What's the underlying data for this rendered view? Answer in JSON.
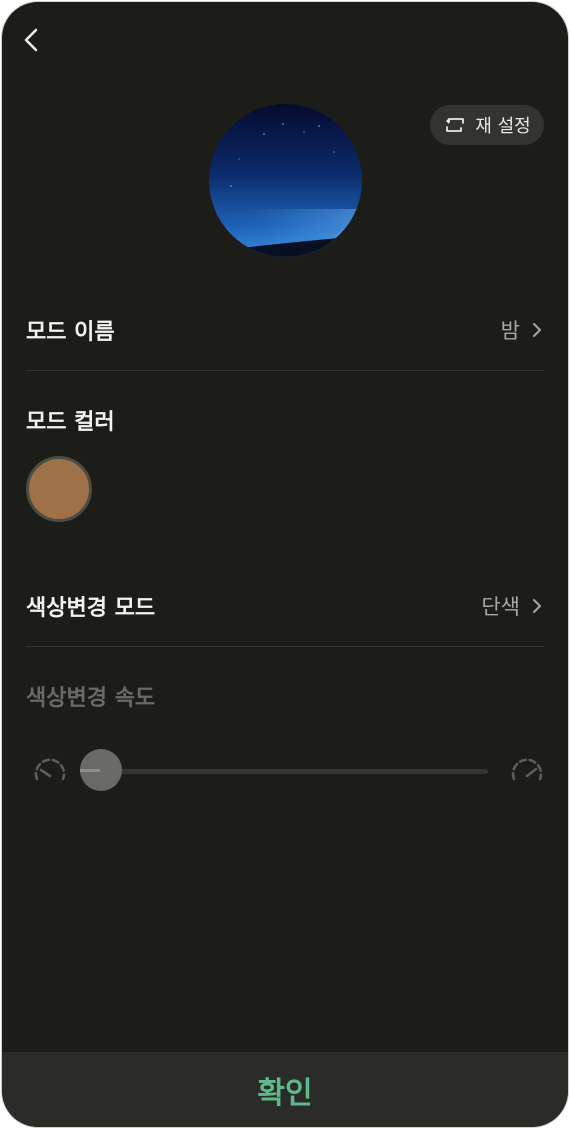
{
  "header": {
    "reset_label": "재 설정"
  },
  "mode_name": {
    "label": "모드 이름",
    "value": "밤"
  },
  "mode_color": {
    "label": "모드 컬러",
    "color": "#9f7149"
  },
  "color_change_mode": {
    "label": "색상변경 모드",
    "value": "단색"
  },
  "color_change_speed": {
    "label": "색상변경 속도",
    "level": 0
  },
  "footer": {
    "confirm_label": "확인"
  },
  "icons": {
    "back": "chevron-left-icon",
    "reset": "reset-icon",
    "chevron": "chevron-right-icon",
    "slow": "speed-slow-icon",
    "fast": "speed-fast-icon"
  },
  "colors": {
    "accent": "#5fb98d",
    "background": "#1c1c18"
  }
}
